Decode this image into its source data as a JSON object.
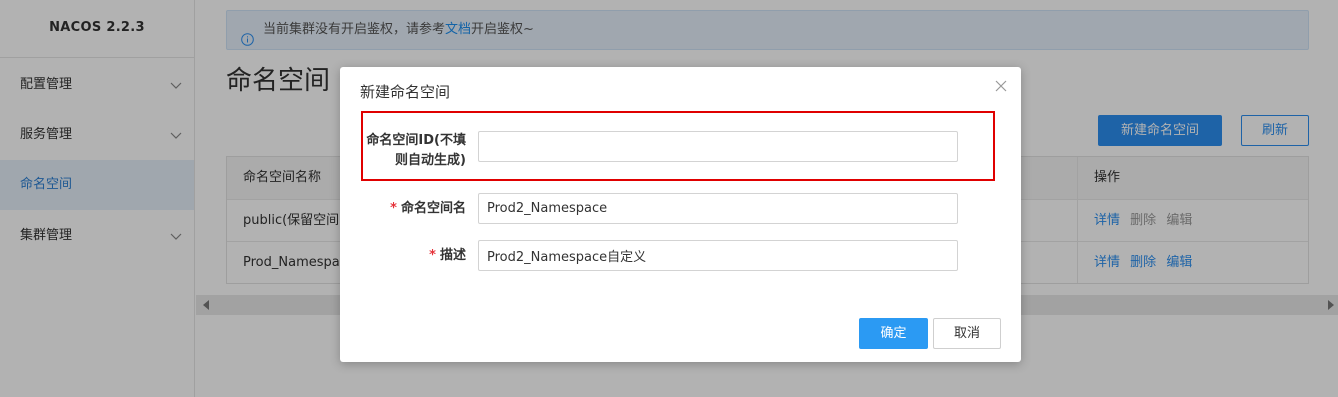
{
  "app": {
    "title": "NACOS 2.2.3"
  },
  "sidebar": {
    "items": [
      {
        "label": "配置管理",
        "active": false,
        "expandable": true
      },
      {
        "label": "服务管理",
        "active": false,
        "expandable": true
      },
      {
        "label": "命名空间",
        "active": true,
        "expandable": false
      },
      {
        "label": "集群管理",
        "active": false,
        "expandable": true
      }
    ]
  },
  "notice": {
    "prefix": "当前集群没有开启鉴权，请参考",
    "link": "文档",
    "suffix": "开启鉴权~"
  },
  "page": {
    "title": "命名空间",
    "new_button": "新建命名空间",
    "refresh_button": "刷新"
  },
  "table": {
    "headers": {
      "name": "命名空间名称",
      "ops": "操作"
    },
    "rows": [
      {
        "name": "public(保留空间)",
        "ops": [
          "详情",
          "删除",
          "编辑"
        ],
        "ops_enabled": [
          true,
          false,
          false
        ]
      },
      {
        "name": "Prod_Namespace",
        "ops": [
          "详情",
          "删除",
          "编辑"
        ],
        "ops_enabled": [
          true,
          true,
          true
        ]
      }
    ]
  },
  "dialog": {
    "title": "新建命名空间",
    "fields": {
      "id_label_line1": "命名空间ID(不填",
      "id_label_line2": "则自动生成)",
      "id_value": "",
      "name_label": "命名空间名",
      "name_value": "Prod2_Namespace",
      "desc_label": "描述",
      "desc_value": "Prod2_Namespace自定义"
    },
    "required_mark": "*",
    "ok_button": "确定",
    "cancel_button": "取消"
  },
  "colors": {
    "primary": "#2b8ff0",
    "active_nav_bg": "#e6f0fa",
    "highlight": "#e00000",
    "required": "#e5333a"
  }
}
